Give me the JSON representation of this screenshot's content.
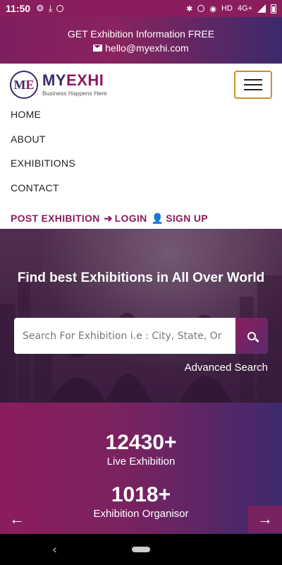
{
  "status_bar": {
    "time": "11:50",
    "network": "HD",
    "network_type": "4G+"
  },
  "topbar": {
    "title": "GET Exhibition Information FREE",
    "email": "hello@myexhi.com"
  },
  "logo": {
    "monogram_m": "M",
    "monogram_e": "E",
    "brand_my": "MY",
    "brand_exhi": "EXHI",
    "tagline": "Business Happens Here"
  },
  "menu": {
    "items": [
      "HOME",
      "ABOUT",
      "EXHIBITIONS",
      "CONTACT"
    ],
    "post_exhibition": "POST EXHIBITION",
    "login": "LOGIN",
    "signup": "SIGN UP"
  },
  "hero": {
    "title": "Find best Exhibitions in All Over World",
    "search_placeholder": "Search For Exhibition i.e : City, State, Or",
    "advanced_search": "Advanced Search"
  },
  "stats": {
    "live_count": "12430+",
    "live_label": "Live Exhibition",
    "organiser_count": "1018+",
    "organiser_label": "Exhibition Organisor"
  },
  "colors": {
    "brand_primary": "#8a1d5c",
    "brand_secondary": "#3b2a6b",
    "menu_button_border": "#c8902a"
  }
}
